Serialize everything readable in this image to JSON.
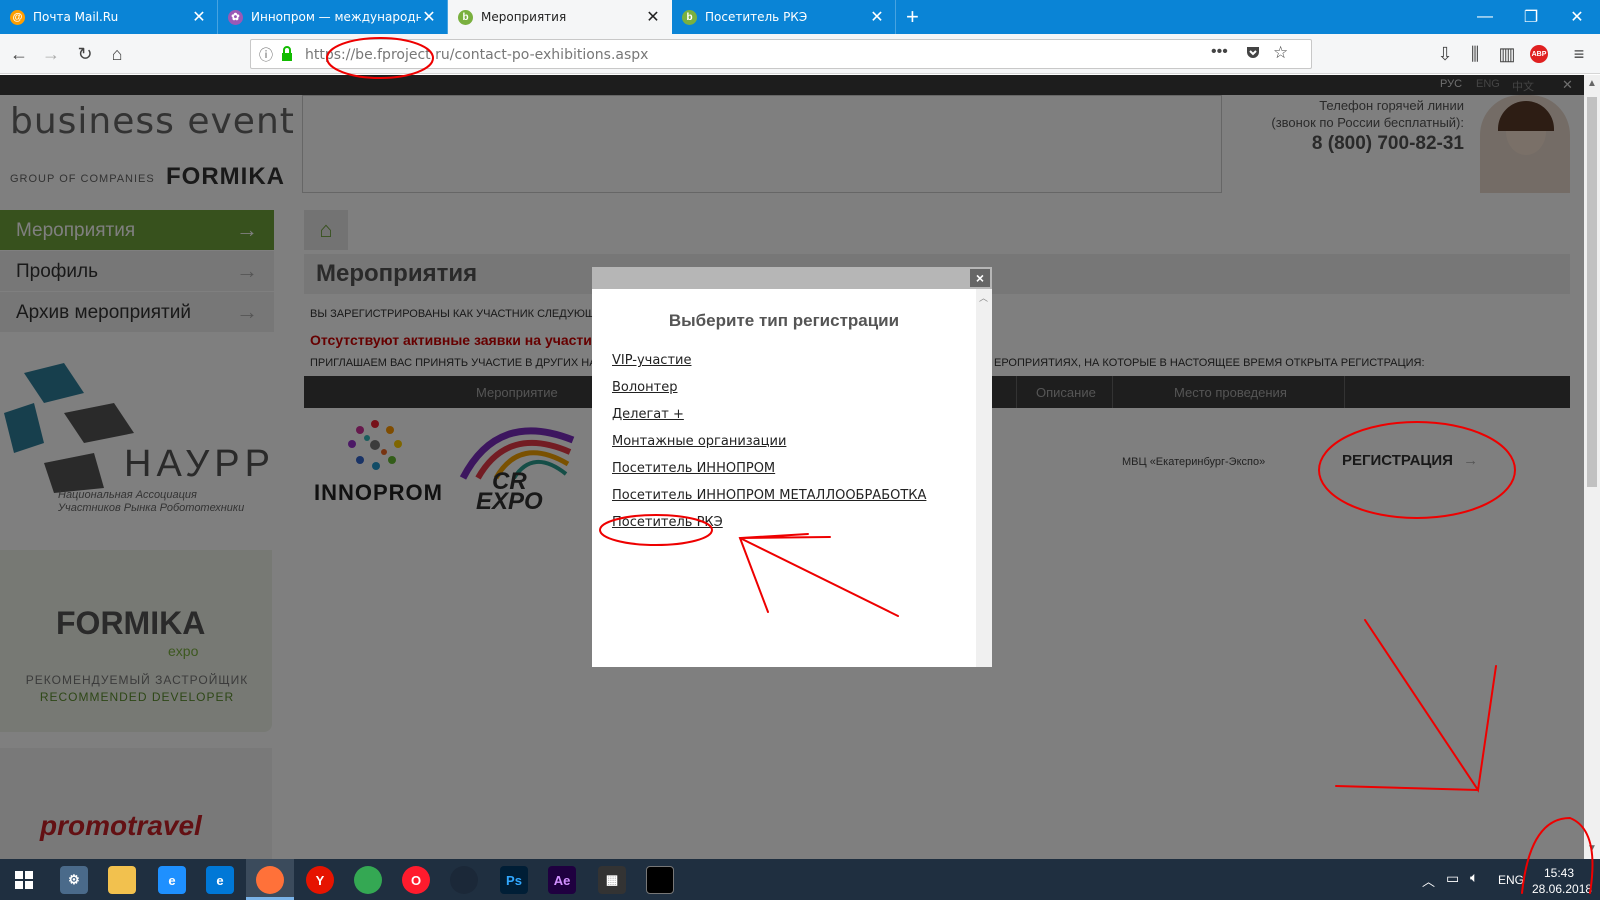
{
  "browser": {
    "tabs": [
      {
        "label": "Почта Mail.Ru",
        "color": "#ff9e00"
      },
      {
        "label": "Иннопром — международная",
        "color": "#9b59b6"
      },
      {
        "label": "Мероприятия",
        "color": "#7ab03f"
      },
      {
        "label": "Посетитель РКЭ",
        "color": "#7ab03f"
      }
    ],
    "new_tab": "+",
    "url": "https://be.fproject.ru/contact-po-exhibitions.aspx",
    "url_icons": [
      "info-icon",
      "lock-icon",
      "more-icon",
      "pocket-icon",
      "star-icon"
    ],
    "toolbar_icons": [
      "downloads-icon",
      "library-icon",
      "sidebar-icon",
      "adblock-icon",
      "menu-icon"
    ],
    "adblock_label": "ABP"
  },
  "site": {
    "languages": [
      "РУС",
      "ENG",
      "中文"
    ],
    "logo": {
      "main": "business event",
      "sub": "GROUP OF COMPANIES",
      "brand": "FORMIKA"
    },
    "hotline": {
      "label_line1": "Телефон горячей линии",
      "label_line2": "(звонок по России бесплатный):",
      "phone": "8 (800) 700-82-31"
    },
    "sidebar": [
      {
        "label": "Мероприятия",
        "active": true
      },
      {
        "label": "Профиль",
        "active": false
      },
      {
        "label": "Архив мероприятий",
        "active": false
      }
    ],
    "banners": {
      "nayrr": "НАУРР",
      "nayrr_sub1": "Национальная Ассоциация",
      "nayrr_sub2": "Участников Рынка Робототехники",
      "formika_expo": "FORMIKA",
      "formika_expo_sub": "expo",
      "rec_dev_ru": "РЕКОМЕНДУЕМЫЙ ЗАСТРОЙЩИК",
      "rec_dev_en": "RECOMMENDED DEVELOPER",
      "promotravel": "promotravel"
    },
    "content": {
      "title": "Мероприятия",
      "registered_notice": "ВЫ ЗАРЕГИСТРИРОВАНЫ КАК УЧАСТНИК СЛЕДУЮЩИХ",
      "no_requests": "Отсутствуют активные заявки на участи",
      "invite_left": "ПРИГЛАШАЕМ ВАС ПРИНЯТЬ УЧАСТИЕ В ДРУГИХ НАШ",
      "invite_right": "ЕРОПРИЯТИЯХ, НА КОТОРЫЕ В НАСТОЯЩЕЕ ВРЕМЯ ОТКРЫТА РЕГИСТРАЦИЯ:",
      "table_headers": [
        "Мероприятие",
        "Описание",
        "Место проведения"
      ],
      "row": {
        "logo1": "INNOPROM",
        "logo2_line1": "CR",
        "logo2_line2": "EXPO",
        "venue": "МВЦ «Екатеринбург-Экспо»",
        "register": "РЕГИСТРАЦИЯ"
      }
    }
  },
  "modal": {
    "title": "Выберите тип регистрации",
    "close": "×",
    "options": [
      "VIP-участие",
      "Волонтер",
      "Делегат +",
      "Монтажные организации",
      "Посетитель ИННОПРОМ",
      "Посетитель ИННОПРОМ МЕТАЛЛООБРАБОТКА",
      "Посетитель РКЭ"
    ]
  },
  "taskbar": {
    "apps": [
      {
        "name": "start-icon",
        "label": "",
        "color": "#1f2f40"
      },
      {
        "name": "settings-app-icon",
        "label": "",
        "color": "#4a6a8a"
      },
      {
        "name": "explorer-icon",
        "label": "",
        "color": "#f2c14e"
      },
      {
        "name": "ie-icon",
        "label": "e",
        "color": "#1e90ff"
      },
      {
        "name": "edge-icon",
        "label": "e",
        "color": "#0078d7"
      },
      {
        "name": "firefox-icon",
        "label": "",
        "color": "#ff7139"
      },
      {
        "name": "yandex-browser-icon",
        "label": "Y",
        "color": "#e61400"
      },
      {
        "name": "chrome-icon",
        "label": "",
        "color": "#34a853"
      },
      {
        "name": "opera-icon",
        "label": "O",
        "color": "#ff1b2d"
      },
      {
        "name": "steam-icon",
        "label": "",
        "color": "#1b2838"
      },
      {
        "name": "photoshop-icon",
        "label": "Ps",
        "color": "#001e36"
      },
      {
        "name": "after-effects-icon",
        "label": "Ae",
        "color": "#1f0040"
      },
      {
        "name": "media-icon",
        "label": "",
        "color": "#333"
      },
      {
        "name": "cmd-icon",
        "label": "",
        "color": "#000"
      }
    ],
    "tray_lang": "ENG",
    "time": "15:43",
    "date": "28.06.2018"
  }
}
